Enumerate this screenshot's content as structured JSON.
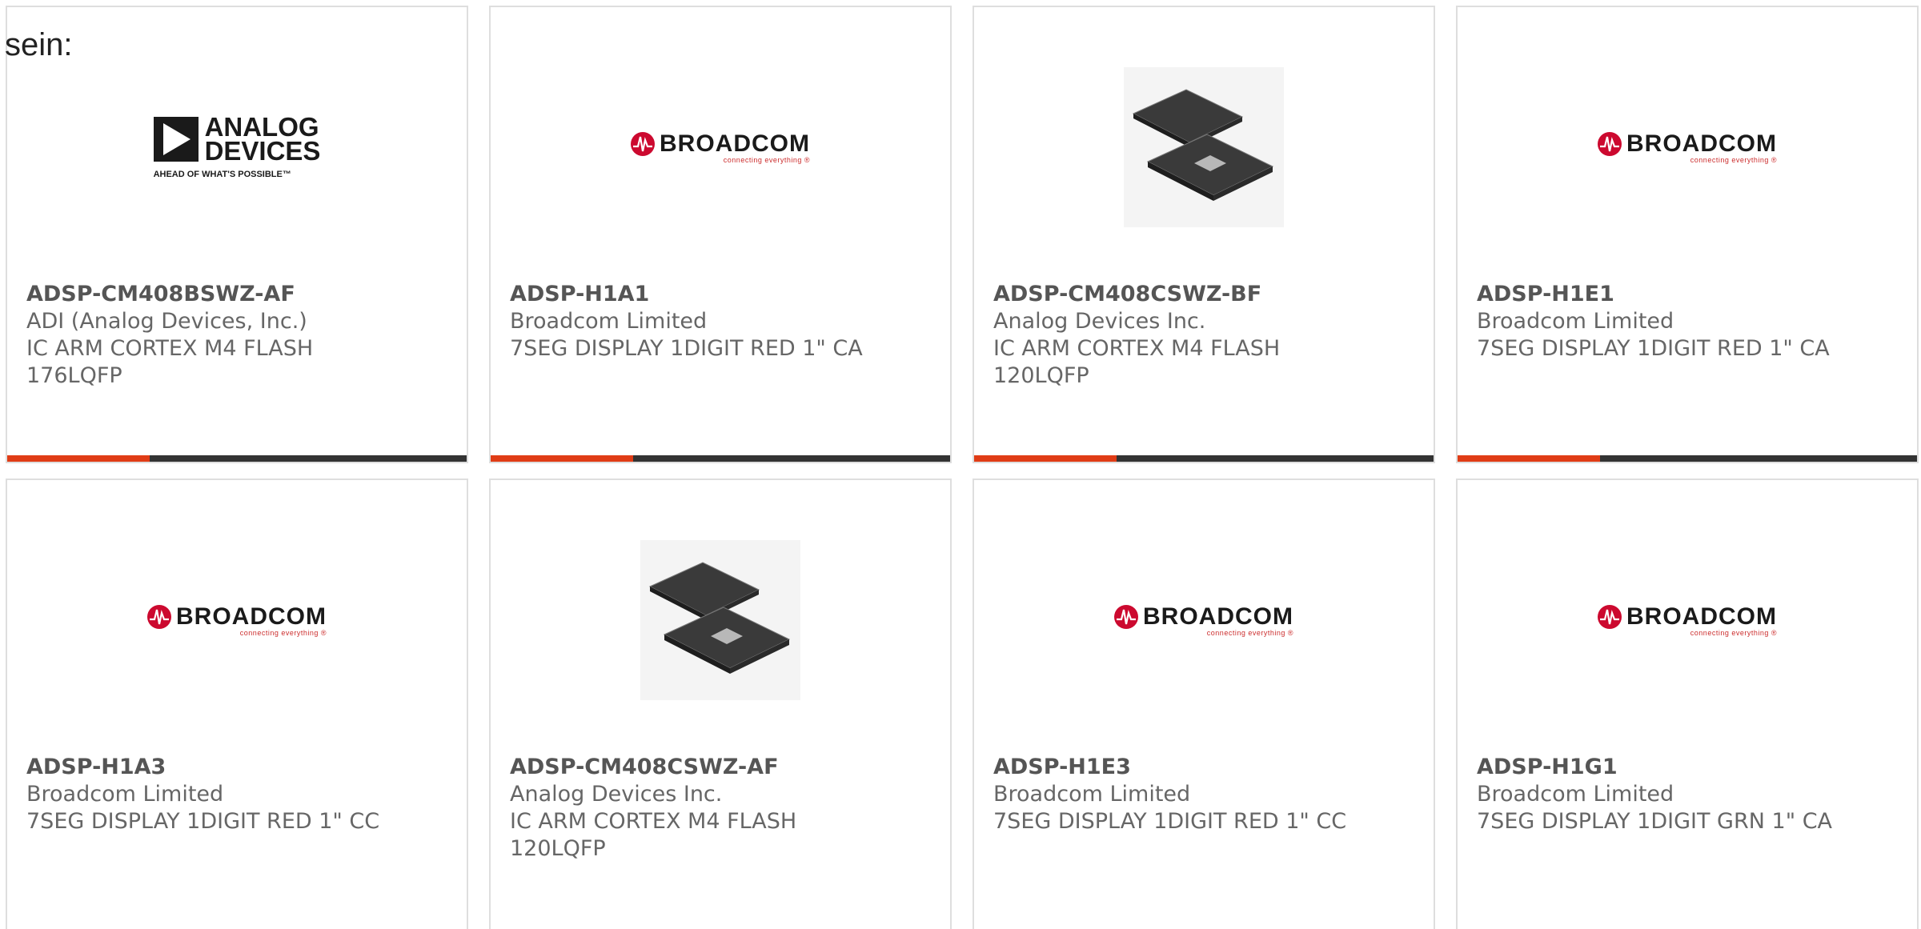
{
  "intro_text": "sein:",
  "accent_color": "#e03c16",
  "bar_color": "#333333",
  "logos": {
    "broadcom": {
      "name": "BROADCOM",
      "registered": "®",
      "tagline": "connecting everything ®",
      "mark_color": "#cc092f"
    },
    "adi": {
      "name_line1": "ANALOG",
      "name_line2": "DEVICES",
      "tagline": "AHEAD OF WHAT'S POSSIBLE™"
    }
  },
  "products": [
    {
      "part_number": "ADSP-CM408BSWZ-AF",
      "manufacturer": "ADI (Analog Devices, Inc.)",
      "description_line1": "IC ARM CORTEX M4 FLASH",
      "description_line2": "176LQFP",
      "image_type": "adi-logo"
    },
    {
      "part_number": "ADSP-H1A1",
      "manufacturer": "Broadcom Limited",
      "description_line1": "7SEG DISPLAY 1DIGIT RED 1\" CA",
      "description_line2": "",
      "image_type": "broadcom-logo"
    },
    {
      "part_number": "ADSP-CM408CSWZ-BF",
      "manufacturer": "Analog Devices Inc.",
      "description_line1": "IC ARM CORTEX M4 FLASH",
      "description_line2": "120LQFP",
      "image_type": "chip-photo"
    },
    {
      "part_number": "ADSP-H1E1",
      "manufacturer": "Broadcom Limited",
      "description_line1": "7SEG DISPLAY 1DIGIT RED 1\" CA",
      "description_line2": "",
      "image_type": "broadcom-logo"
    },
    {
      "part_number": "ADSP-H1A3",
      "manufacturer": "Broadcom Limited",
      "description_line1": "7SEG DISPLAY 1DIGIT RED 1\" CC",
      "description_line2": "",
      "image_type": "broadcom-logo"
    },
    {
      "part_number": "ADSP-CM408CSWZ-AF",
      "manufacturer": "Analog Devices Inc.",
      "description_line1": "IC ARM CORTEX M4 FLASH",
      "description_line2": "120LQFP",
      "image_type": "chip-photo"
    },
    {
      "part_number": "ADSP-H1E3",
      "manufacturer": "Broadcom Limited",
      "description_line1": "7SEG DISPLAY 1DIGIT RED 1\" CC",
      "description_line2": "",
      "image_type": "broadcom-logo"
    },
    {
      "part_number": "ADSP-H1G1",
      "manufacturer": "Broadcom Limited",
      "description_line1": "7SEG DISPLAY 1DIGIT GRN 1\" CA",
      "description_line2": "",
      "image_type": "broadcom-logo"
    }
  ]
}
